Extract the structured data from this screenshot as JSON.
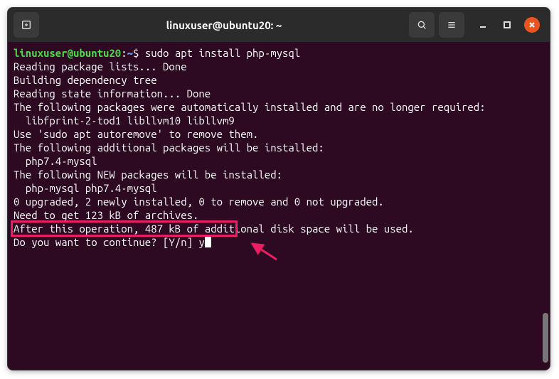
{
  "window": {
    "title": "linuxuser@ubuntu20: ~"
  },
  "prompt": {
    "user_host": "linuxuser@ubuntu20",
    "colon": ":",
    "path": "~",
    "dollar": "$"
  },
  "command": " sudo apt install php-mysql",
  "output_lines": [
    "Reading package lists... Done",
    "Building dependency tree",
    "Reading state information... Done",
    "The following packages were automatically installed and are no longer required:",
    "  libfprint-2-tod1 libllvm10 libllvm9",
    "Use 'sudo apt autoremove' to remove them.",
    "The following additional packages will be installed:",
    "  php7.4-mysql",
    "The following NEW packages will be installed:",
    "  php-mysql php7.4-mysql",
    "0 upgraded, 2 newly installed, 0 to remove and 0 not upgraded.",
    "Need to get 123 kB of archives.",
    "After this operation, 487 kB of additional disk space will be used."
  ],
  "prompt_line": {
    "question": "Do you want to continue? [Y/n] ",
    "answer": "y"
  }
}
